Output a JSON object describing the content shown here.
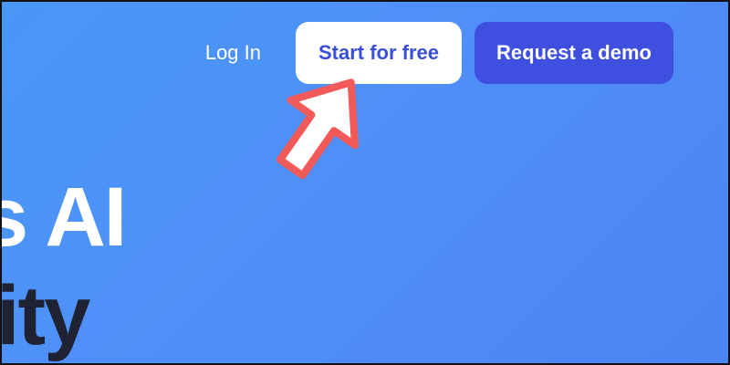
{
  "nav": {
    "login_label": "Log In",
    "start_label": "Start for free",
    "demo_label": "Request a demo"
  },
  "hero": {
    "line1": "s AI",
    "line2": "ity"
  },
  "annotation": {
    "icon": "pointer-arrow-icon",
    "color": "#f25a5a"
  },
  "colors": {
    "background": "#4f8ff7",
    "start_button_bg": "#ffffff",
    "start_button_text": "#3a4fd8",
    "demo_button_bg": "#3f4fe0",
    "demo_button_text": "#ffffff",
    "hero_line1_text": "#ffffff",
    "hero_line2_text": "#1f2233"
  }
}
